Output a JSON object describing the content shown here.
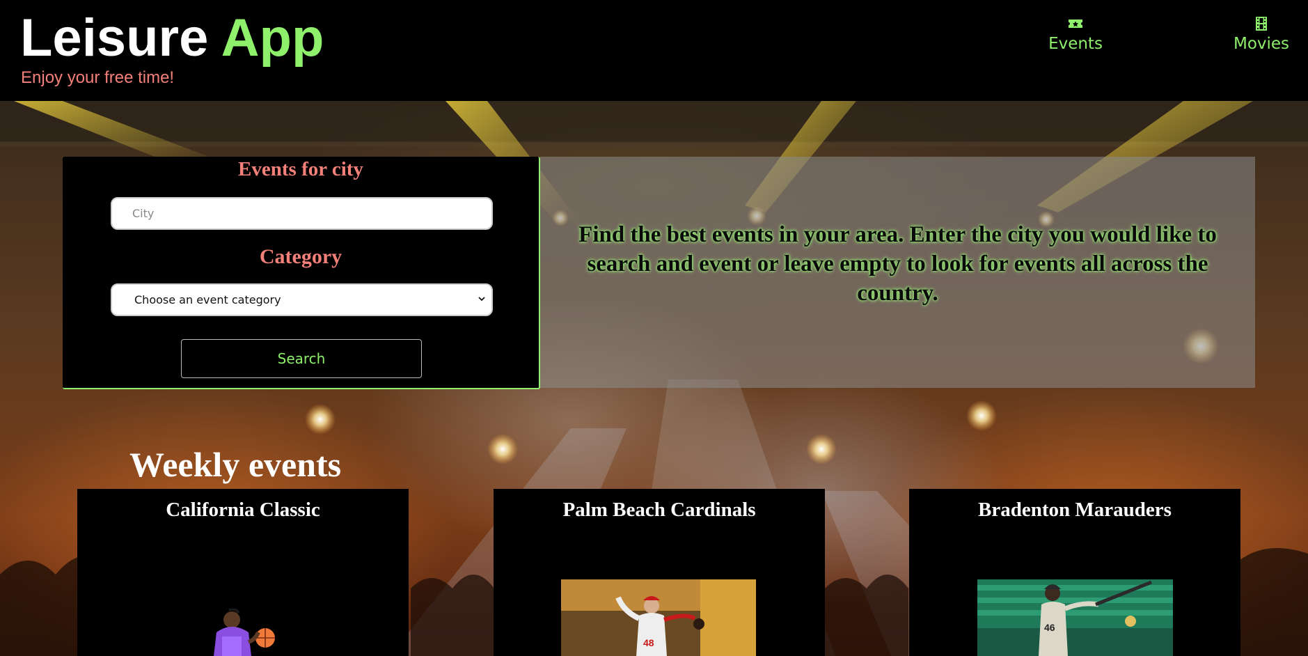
{
  "header": {
    "brand_primary": "Leisure",
    "brand_accent": "App",
    "tagline": "Enjoy your free time!",
    "nav": [
      {
        "label": "Events",
        "icon": "ticket-icon"
      },
      {
        "label": "Movies",
        "icon": "film-icon"
      }
    ]
  },
  "search": {
    "city_heading": "Events for city",
    "city_placeholder": "City",
    "category_heading": "Category",
    "category_selected": "Choose an event category",
    "button_label": "Search"
  },
  "info": {
    "text": "Find the best events in your area. Enter the city you would like to search and event or leave empty to look for events all across the country."
  },
  "weekly": {
    "title": "Weekly events",
    "events": [
      {
        "title": "California Classic"
      },
      {
        "title": "Palm Beach Cardinals"
      },
      {
        "title": "Bradenton Marauders"
      }
    ]
  },
  "colors": {
    "accent_green": "#8ef06b",
    "accent_salmon": "#f4807a",
    "background": "#000000"
  }
}
